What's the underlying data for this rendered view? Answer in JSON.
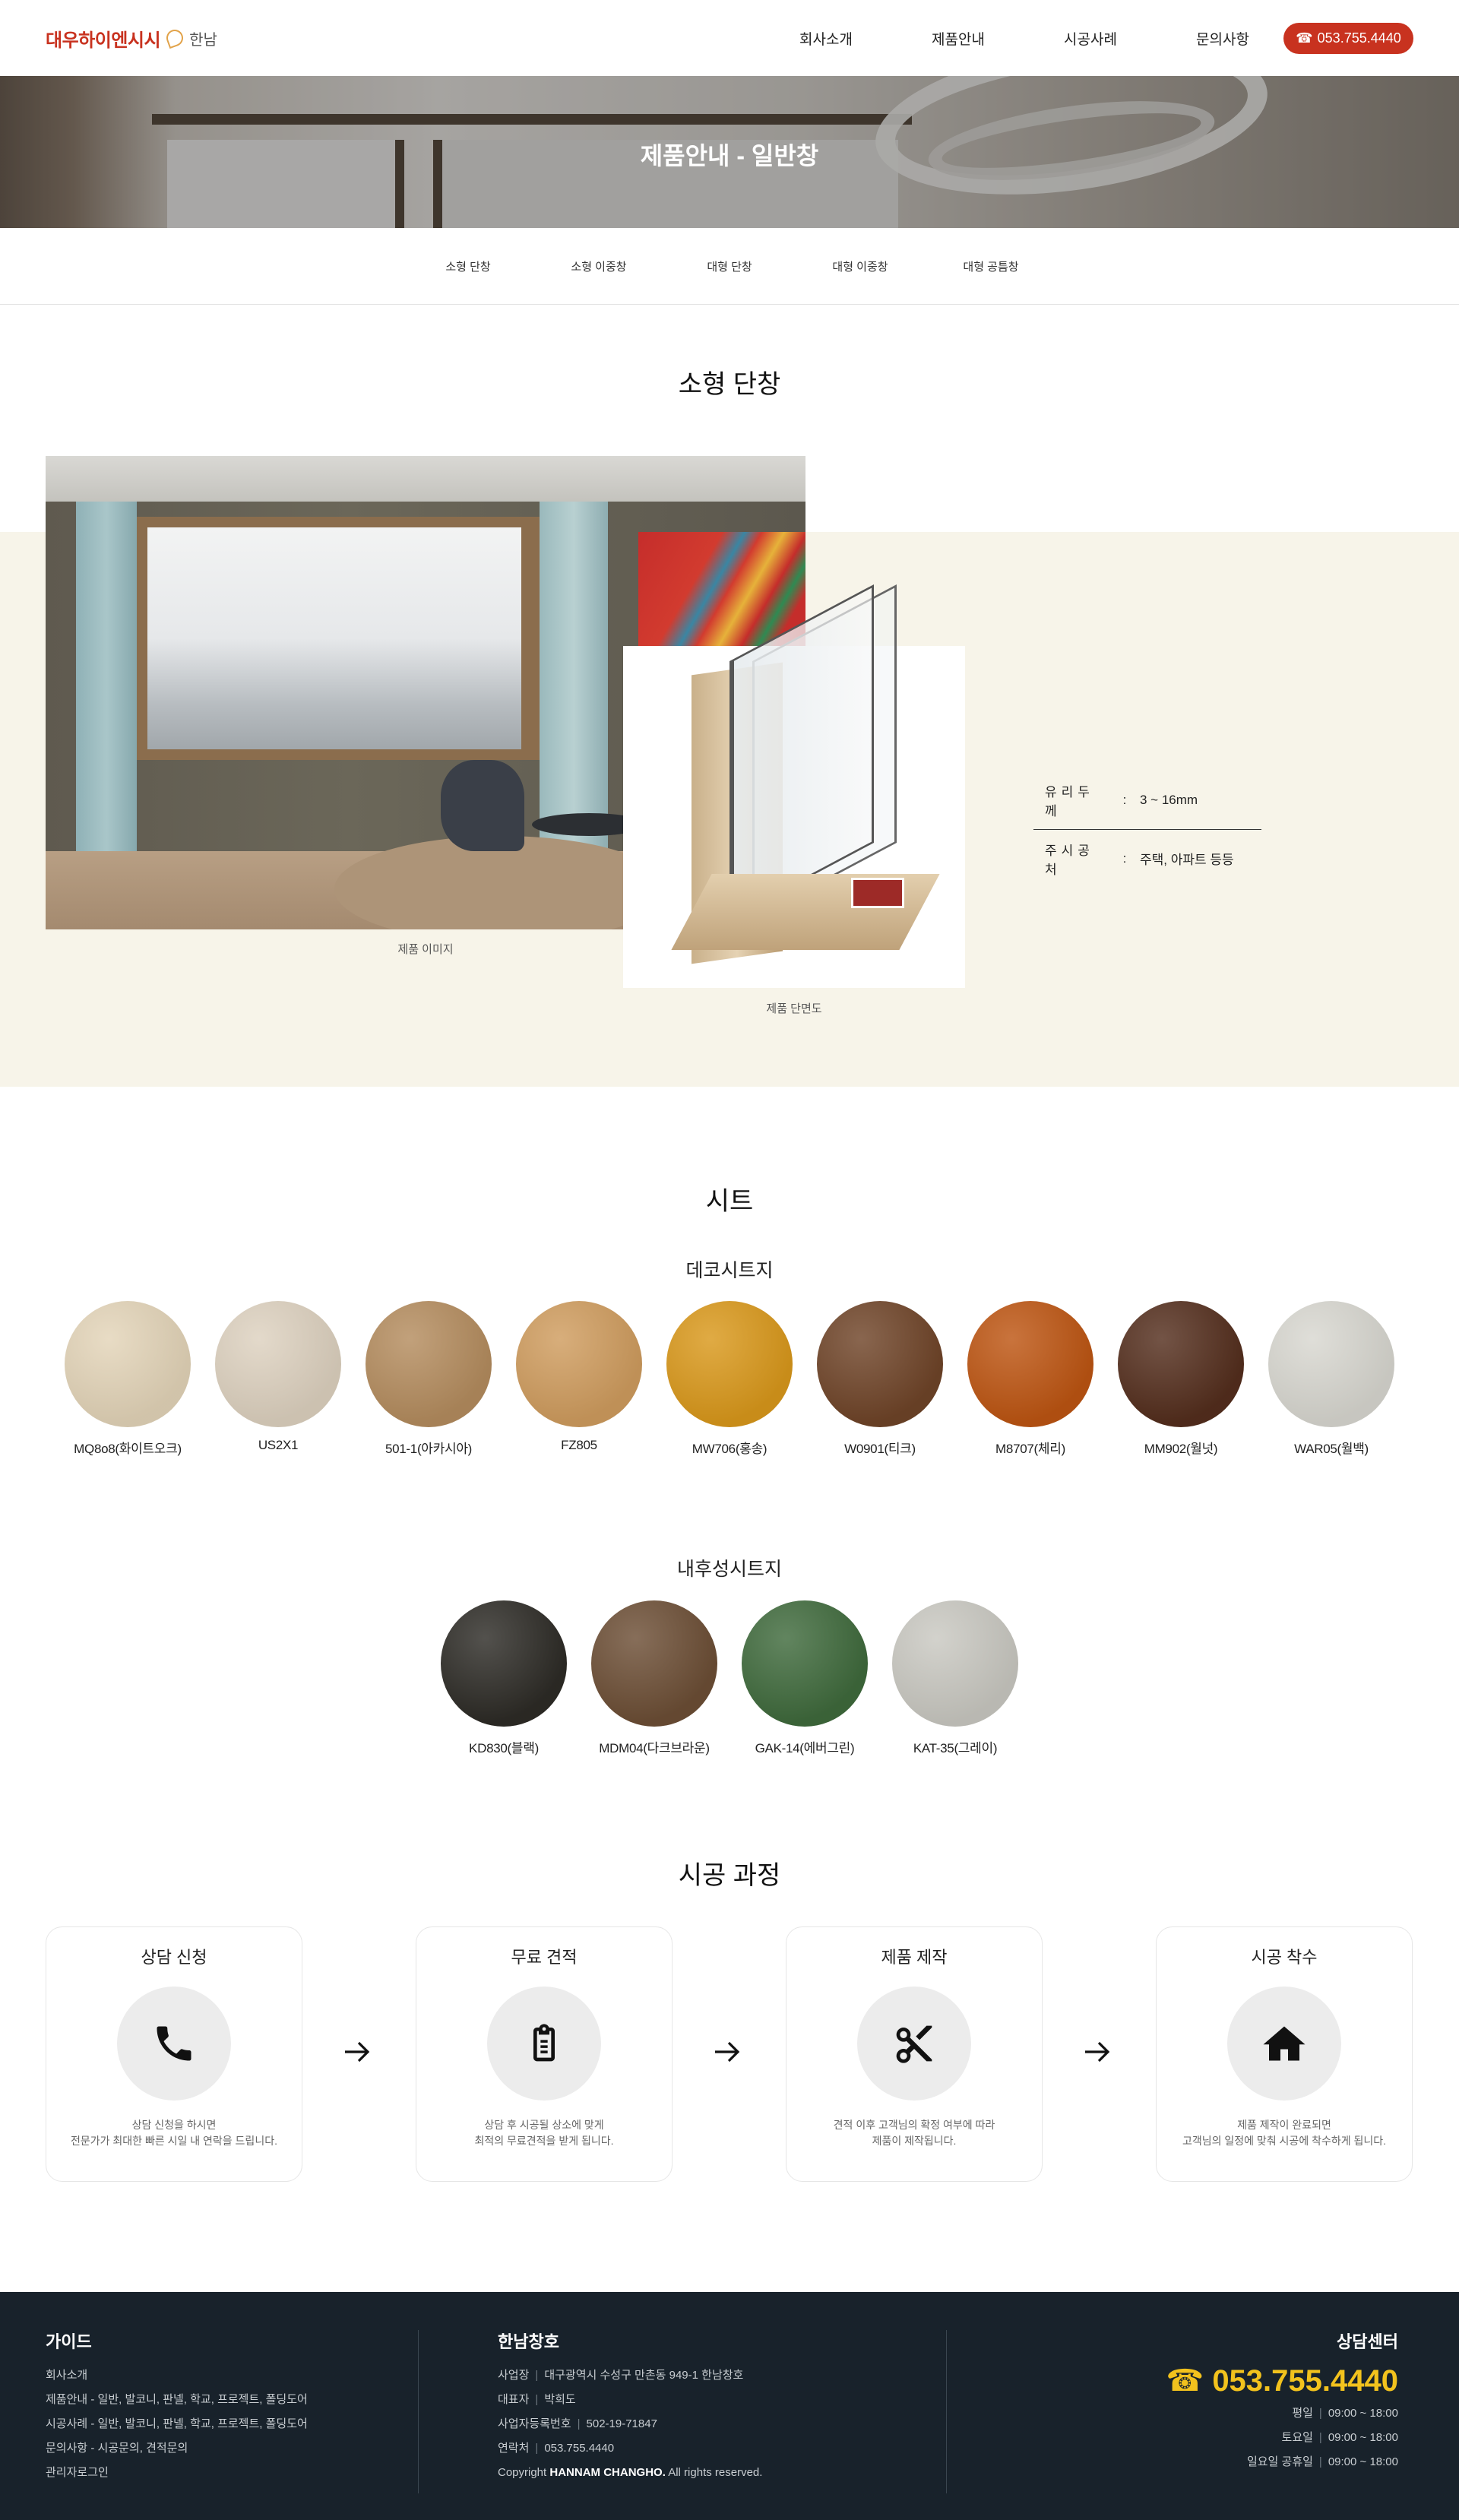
{
  "header": {
    "logo_text": "대우하이엔시시",
    "logo_sub": "한남",
    "nav": [
      "회사소개",
      "제품안내",
      "시공사례",
      "문의사항"
    ],
    "phone_icon": "☎",
    "phone": "053.755.4440"
  },
  "hero": {
    "title": "제품안내 - 일반창"
  },
  "subtabs": [
    "소형 단창",
    "소형 이중창",
    "대형 단창",
    "대형 이중창",
    "대형 공틈창"
  ],
  "product": {
    "title": "소형 단창",
    "image_caption": "제품 이미지",
    "section_caption": "제품 단면도",
    "specs": [
      {
        "label": "유리두께",
        "value": "3 ~ 16mm"
      },
      {
        "label": "주시공처",
        "value": "주택, 아파트 등등"
      }
    ]
  },
  "sheet": {
    "title": "시트",
    "deco_title": "데코시트지",
    "deco": [
      {
        "name": "MQ8o8(화이트오크)",
        "color": "#e3d4b8"
      },
      {
        "name": "US2X1",
        "color": "#ddd1bf"
      },
      {
        "name": "501-1(아카시아)",
        "color": "#b48c5e"
      },
      {
        "name": "FZ805",
        "color": "#cf9c5e"
      },
      {
        "name": "MW706(홍송)",
        "color": "#d9981b"
      },
      {
        "name": "W0901(티크)",
        "color": "#6f4428"
      },
      {
        "name": "M8707(체리)",
        "color": "#bd5512"
      },
      {
        "name": "MM902(월넛)",
        "color": "#542e1d"
      },
      {
        "name": "WAR05(월백)",
        "color": "#d8d7d0"
      }
    ],
    "weather_title": "내후성시트지",
    "weather": [
      {
        "name": "KD830(블랙)",
        "color": "#2d2b26"
      },
      {
        "name": "MDM04(다크브라운)",
        "color": "#6c4e35"
      },
      {
        "name": "GAK-14(에버그린)",
        "color": "#3f6a3c"
      },
      {
        "name": "KAT-35(그레이)",
        "color": "#c9c8c1"
      }
    ]
  },
  "process": {
    "title": "시공 과정",
    "steps": [
      {
        "title": "상담 신청",
        "icon": "phone-icon",
        "desc1": "상담 신청을 하시면",
        "desc2": "전문가가 최대한 빠른 시일 내 연락을 드립니다."
      },
      {
        "title": "무료 견적",
        "icon": "clipboard-icon",
        "desc1": "상담 후 시공될 상소에 맞게",
        "desc2": "최적의 무료견적을 받게 됩니다."
      },
      {
        "title": "제품 제작",
        "icon": "scissors-icon",
        "desc1": "견적 이후 고객님의 확정 여부에 따라",
        "desc2": "제품이 제작됩니다."
      },
      {
        "title": "시공 착수",
        "icon": "home-icon",
        "desc1": "제품 제작이 완료되면",
        "desc2": "고객님의 일정에 맞춰 시공에 착수하게 됩니다."
      }
    ]
  },
  "footer": {
    "guide_title": "가이드",
    "guide_lines": [
      "회사소개",
      "제품안내 - 일반, 발코니, 판넬, 학교, 프로젝트, 폴딩도어",
      "시공사례 - 일반, 발코니, 판넬, 학교, 프로젝트, 폴딩도어",
      "문의사항 - 시공문의, 견적문의",
      "관리자로그인"
    ],
    "company_title": "한남창호",
    "company_rows": [
      {
        "k": "사업장",
        "v": "대구광역시 수성구 만촌동 949-1 한남창호"
      },
      {
        "k": "대표자",
        "v": "박희도"
      },
      {
        "k": "사업자등록번호",
        "v": "502-19-71847"
      },
      {
        "k": "연락처",
        "v": "053.755.4440"
      }
    ],
    "copyright_pre": "Copyright",
    "copyright_brand": "HANNAM CHANGHO.",
    "copyright_post": "All rights reserved.",
    "center_title": "상담센터",
    "center_phone": "☎ 053.755.4440",
    "hours": [
      {
        "day": "평일",
        "time": "09:00 ~ 18:00"
      },
      {
        "day": "토요일",
        "time": "09:00 ~ 18:00"
      },
      {
        "day": "일요일 공휴일",
        "time": "09:00 ~ 18:00"
      }
    ]
  }
}
